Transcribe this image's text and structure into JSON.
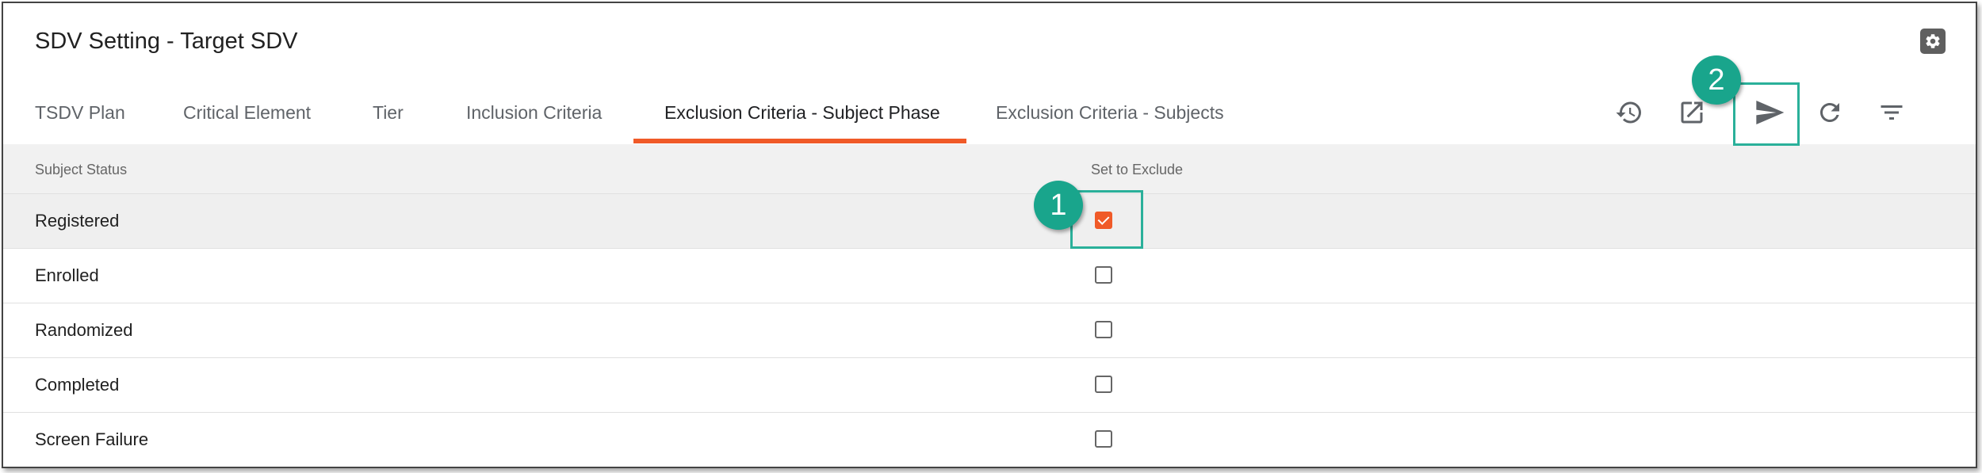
{
  "header": {
    "title": "SDV Setting - Target SDV"
  },
  "tabs": [
    {
      "label": "TSDV Plan"
    },
    {
      "label": "Critical Element"
    },
    {
      "label": "Tier"
    },
    {
      "label": "Inclusion Criteria"
    },
    {
      "label": "Exclusion Criteria - Subject Phase"
    },
    {
      "label": "Exclusion Criteria - Subjects"
    }
  ],
  "active_tab": "Exclusion Criteria - Subject Phase",
  "toolbar": {
    "icons": [
      "history-icon",
      "open-external-icon",
      "send-icon",
      "refresh-icon",
      "filter-icon"
    ]
  },
  "table": {
    "columns": [
      "Subject Status",
      "Set to Exclude"
    ],
    "rows": [
      {
        "status": "Registered",
        "exclude": true
      },
      {
        "status": "Enrolled",
        "exclude": false
      },
      {
        "status": "Randomized",
        "exclude": false
      },
      {
        "status": "Completed",
        "exclude": false
      },
      {
        "status": "Screen Failure",
        "exclude": false
      }
    ]
  },
  "callouts": [
    {
      "number": "1",
      "target": "Registered exclude checkbox"
    },
    {
      "number": "2",
      "target": "send button"
    }
  ],
  "colors": {
    "accent": "#f05a28",
    "callout": "#19a58c"
  }
}
